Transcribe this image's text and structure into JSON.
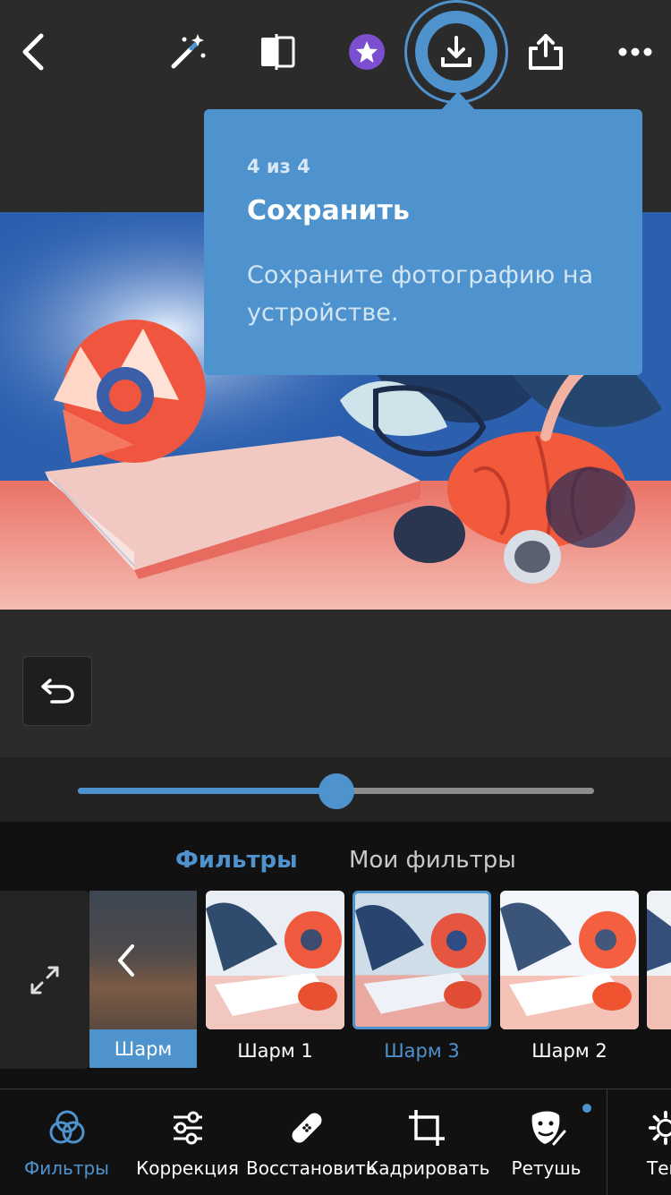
{
  "toolbar": {
    "icons": [
      "back-icon",
      "magic-wand-icon",
      "compare-icon",
      "premium-star-icon",
      "save-download-icon",
      "share-icon",
      "more-icon"
    ]
  },
  "coachmark": {
    "step": "4 из 4",
    "title": "Сохранить",
    "description": "Сохраните фотографию на устройстве."
  },
  "slider": {
    "value": 0.5
  },
  "filters": {
    "tabs": [
      {
        "label": "Фильтры",
        "active": true
      },
      {
        "label": "Мои фильтры",
        "active": false
      }
    ],
    "group_label": "Шарм",
    "items": [
      {
        "label": "Шарм 1",
        "selected": false
      },
      {
        "label": "Шарм 3",
        "selected": true
      },
      {
        "label": "Шарм 2",
        "selected": false
      }
    ]
  },
  "bottom_nav": {
    "items": [
      {
        "label": "Фильтры",
        "icon": "filters-icon",
        "active": true
      },
      {
        "label": "Коррекция",
        "icon": "sliders-icon",
        "active": false
      },
      {
        "label": "Восстановить",
        "icon": "bandage-icon",
        "active": false
      },
      {
        "label": "Кадрировать",
        "icon": "crop-icon",
        "active": false
      },
      {
        "label": "Ретушь",
        "icon": "retouch-face-icon",
        "active": false
      },
      {
        "label": "Тем",
        "icon": "themes-icon",
        "active": false
      }
    ]
  },
  "colors": {
    "accent": "#4e93ce",
    "background": "#2b2b2b",
    "panel": "#111111",
    "premium": "#7b4fcf"
  }
}
